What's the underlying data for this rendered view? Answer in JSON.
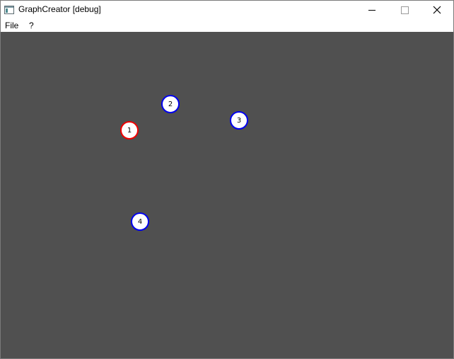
{
  "window": {
    "title": "GraphCreator [debug]",
    "app_icon": "window-app-icon"
  },
  "menu": {
    "items": [
      "File",
      "?"
    ]
  },
  "graph": {
    "nodes": [
      {
        "label": "1",
        "state": "selected",
        "color": "#ee0000"
      },
      {
        "label": "2",
        "state": "normal",
        "color": "#0000ee"
      },
      {
        "label": "3",
        "state": "normal",
        "color": "#0000ee"
      },
      {
        "label": "4",
        "state": "normal",
        "color": "#0000ee"
      }
    ]
  },
  "colors": {
    "canvas_background": "#505050",
    "node_fill": "#ffffff",
    "node_border": "#0000ee",
    "selected_node_border": "#ee0000"
  }
}
